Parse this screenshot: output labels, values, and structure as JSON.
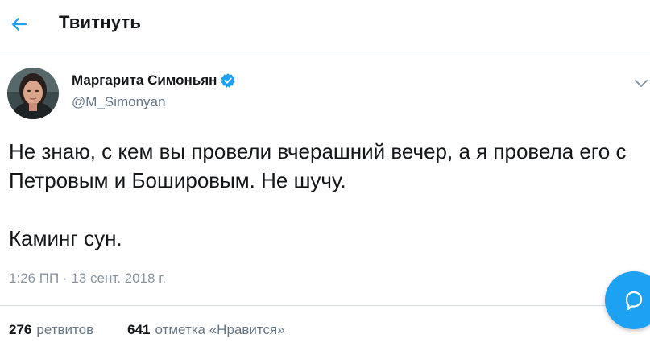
{
  "header": {
    "back_icon": "arrow-left-icon",
    "title": "Твитнуть"
  },
  "tweet": {
    "author_name": "Маргарита Симоньян",
    "verified_icon": "verified-badge-icon",
    "handle": "@M_Simonyan",
    "menu_icon": "chevron-down-icon",
    "text_paragraphs": [
      "Не знаю, с кем вы провели вчерашний вечер, а я провела его с Петровым и Бошировым. Не шучу.",
      "Каминг сун."
    ],
    "timestamp": "1:26 ПП · 13 сент. 2018 г."
  },
  "stats": {
    "retweets_count": "276",
    "retweets_label": "ретвитов",
    "likes_count": "641",
    "likes_label": "отметка «Нравится»"
  },
  "fab": {
    "icon": "compose-reply-icon"
  },
  "colors": {
    "accent": "#1da1f2",
    "text_primary": "#14171a",
    "text_secondary": "#657786"
  }
}
